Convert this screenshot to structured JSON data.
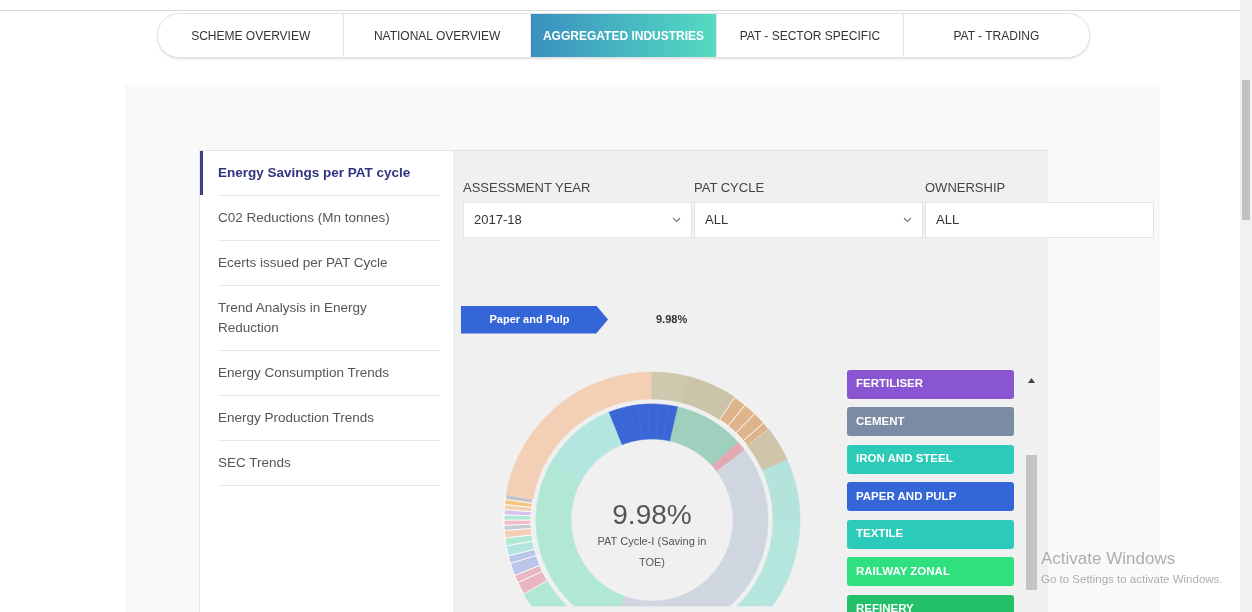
{
  "tabs": [
    {
      "label": "SCHEME OVERVIEW",
      "selected": false
    },
    {
      "label": "NATIONAL OVERVIEW",
      "selected": false
    },
    {
      "label": "AGGREGATED INDUSTRIES",
      "selected": true
    },
    {
      "label": "PAT - SECTOR SPECIFIC",
      "selected": false
    },
    {
      "label": "PAT - TRADING",
      "selected": false
    }
  ],
  "sidebar": {
    "items": [
      {
        "label": "Energy Savings per PAT cycle",
        "selected": true
      },
      {
        "label": "C02 Reductions (Mn tonnes)",
        "selected": false
      },
      {
        "label": "Ecerts issued per PAT Cycle",
        "selected": false
      },
      {
        "label": "Trend Analysis in Energy Reduction",
        "selected": false
      },
      {
        "label": "Energy Consumption Trends",
        "selected": false
      },
      {
        "label": "Energy Production Trends",
        "selected": false
      },
      {
        "label": "SEC Trends",
        "selected": false
      }
    ]
  },
  "filters": [
    {
      "label": "ASSESSMENT YEAR",
      "value": "2017-18",
      "kind": "dropdown"
    },
    {
      "label": "PAT CYCLE",
      "value": "ALL",
      "kind": "dropdown"
    },
    {
      "label": "OWNERSHIP",
      "value": "ALL",
      "kind": "text"
    }
  ],
  "breadcrumb": {
    "label": "Paper and Pulp",
    "percent": "9.98%"
  },
  "chart_center": {
    "value": "9.98%",
    "caption": "PAT Cycle-I (Saving in TOE)"
  },
  "legend": [
    {
      "label": "FERTILISER",
      "color": "#8a55d0"
    },
    {
      "label": "CEMENT",
      "color": "#7a8ba3"
    },
    {
      "label": "IRON AND STEEL",
      "color": "#2bcbb8"
    },
    {
      "label": "PAPER AND PULP",
      "color": "#3566d8"
    },
    {
      "label": "TEXTILE",
      "color": "#2ccab9"
    },
    {
      "label": "RAILWAY ZONAL",
      "color": "#2ee07e"
    },
    {
      "label": "REFINERY",
      "color": "#22c068"
    }
  ],
  "os_notice": {
    "title": "Activate Windows",
    "subtitle": "Go to Settings to activate Windows."
  }
}
